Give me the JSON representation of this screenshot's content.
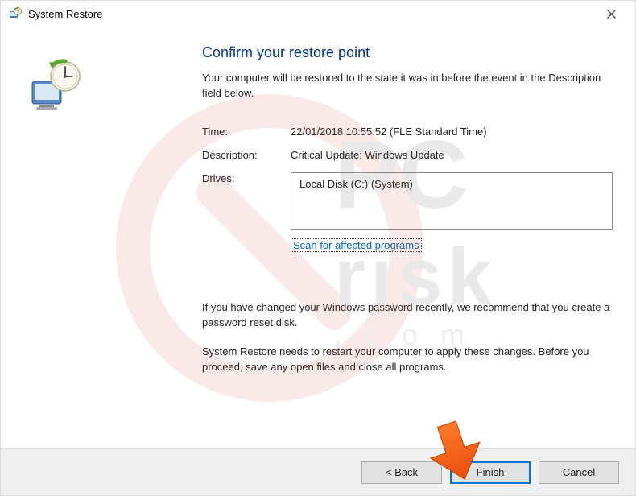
{
  "titlebar": {
    "title": "System Restore"
  },
  "main": {
    "heading": "Confirm your restore point",
    "subtext": "Your computer will be restored to the state it was in before the event in the Description field below.",
    "time_label": "Time:",
    "time_value": "22/01/2018 10:55:52 (FLE Standard Time)",
    "description_label": "Description:",
    "description_value": "Critical Update: Windows Update",
    "drives_label": "Drives:",
    "drives_value": "Local Disk (C:) (System)",
    "scan_link": "Scan for affected programs",
    "password_warning": "If you have changed your Windows password recently, we recommend that you create a password reset disk.",
    "restart_warning": "System Restore needs to restart your computer to apply these changes. Before you proceed, save any open files and close all programs."
  },
  "footer": {
    "back": "< Back",
    "finish": "Finish",
    "cancel": "Cancel"
  }
}
